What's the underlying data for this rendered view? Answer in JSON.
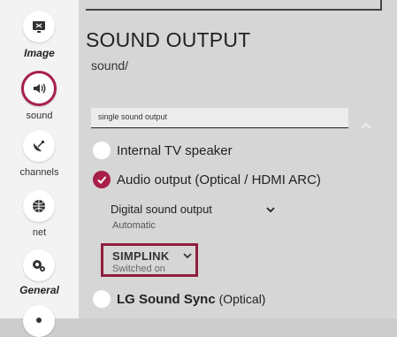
{
  "sidebar": {
    "items": [
      {
        "label": "Image",
        "icon": "image-icon"
      },
      {
        "label": "sound",
        "icon": "sound-icon"
      },
      {
        "label": "channels",
        "icon": "satellite-dish-icon"
      },
      {
        "label": "net",
        "icon": "globe-icon"
      },
      {
        "label": "General",
        "icon": "gears-icon"
      }
    ]
  },
  "page": {
    "title": "SOUND OUTPUT",
    "breadcrumb": "sound/"
  },
  "section": {
    "label": "single sound output"
  },
  "options": {
    "internal": "Internal TV speaker",
    "audio": "Audio output (Optical / HDMI ARC)",
    "lg_sync_bold": "LG Sound Sync",
    "lg_sync_suffix": " (Optical)"
  },
  "digital_sound": {
    "label": "Digital sound output",
    "value": "Automatic"
  },
  "simplink": {
    "label": "SIMPLINK",
    "value": "Switched on"
  },
  "colors": {
    "accent": "#a8204a",
    "highlight_border": "#8e1f3d"
  }
}
